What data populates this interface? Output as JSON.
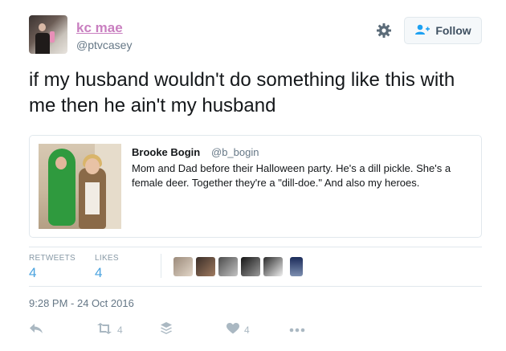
{
  "user": {
    "name": "kc mae",
    "handle": "@ptvcasey"
  },
  "header": {
    "follow_label": "Follow",
    "settings_icon": "gear-icon",
    "follow_icon": "add-user-icon"
  },
  "tweet": {
    "text": "if my husband wouldn't do something like this with me then he ain't my husband"
  },
  "quoted": {
    "name": "Brooke Bogin",
    "handle": "@b_bogin",
    "text": "Mom and Dad before their Halloween party. He's a dill pickle. She's a female deer. Together they're a \"dill-doe.\" And also my heroes."
  },
  "stats": {
    "retweets_label": "RETWEETS",
    "retweets": "4",
    "likes_label": "LIKES",
    "likes": "4"
  },
  "timestamp": "9:28 PM - 24 Oct 2016",
  "actions": {
    "retweet_count": "4",
    "like_count": "4"
  },
  "colors": {
    "name": "#c97fc0",
    "stat": "#4aa3df",
    "muted": "#657786",
    "border": "#e1e8ed"
  }
}
